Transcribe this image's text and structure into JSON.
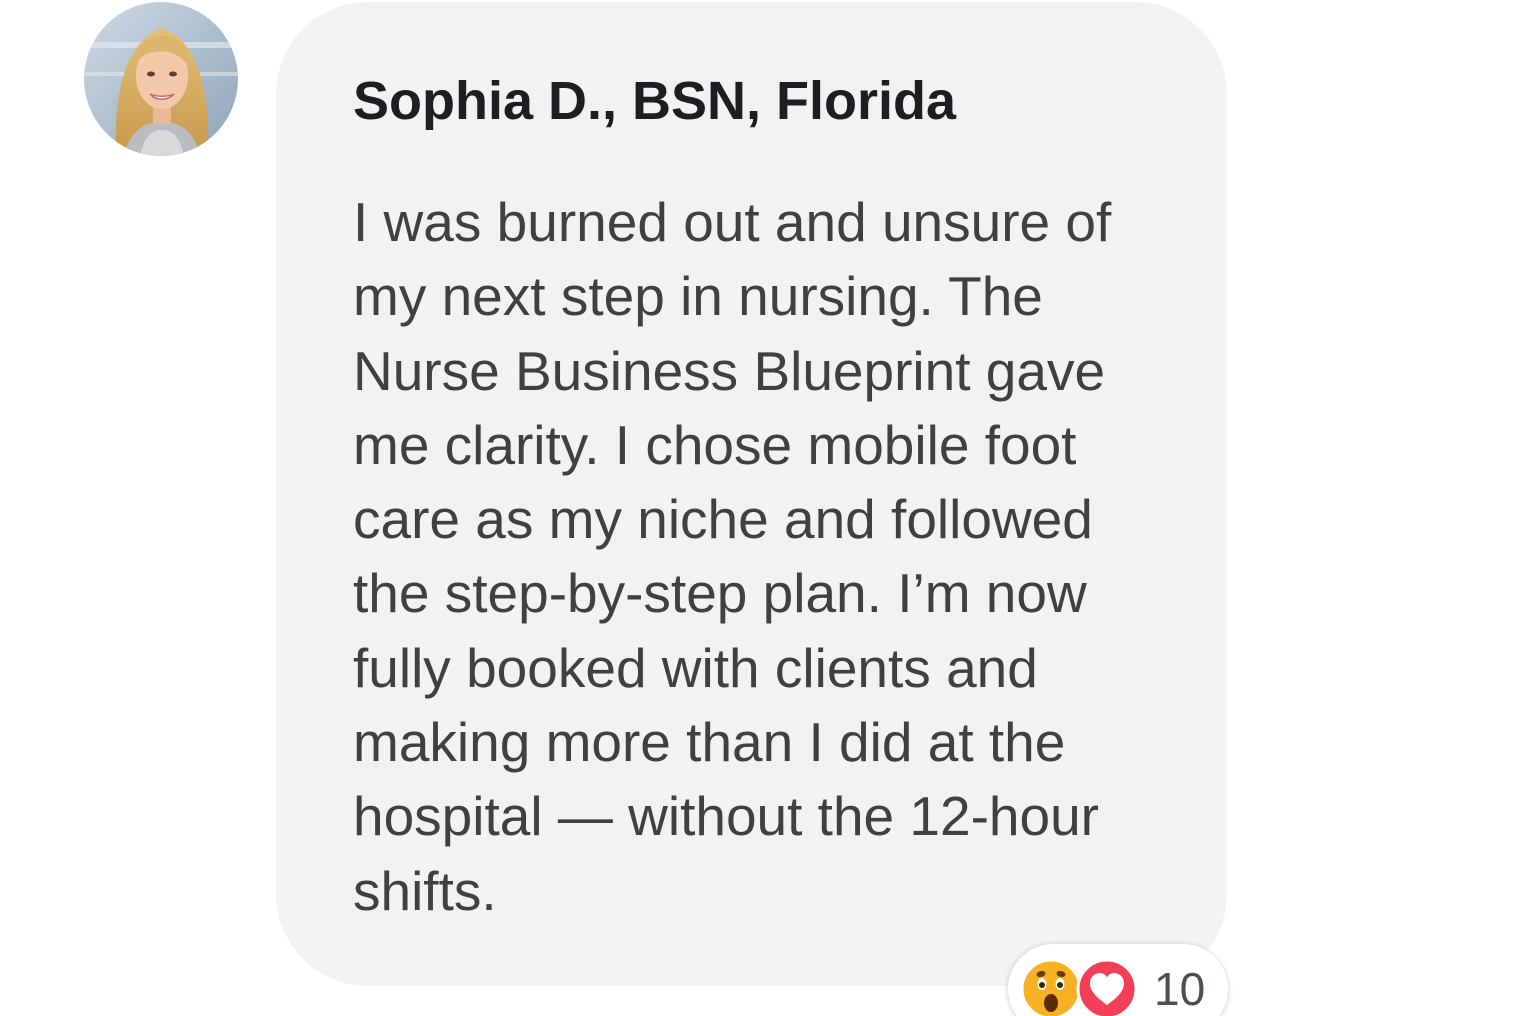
{
  "comment": {
    "author": "Sophia D., BSN, Florida",
    "avatar_icon": "profile-photo-avatar",
    "body_lines": [
      "I was burned out and unsure of",
      "my next step in nursing. The",
      "Nurse Business Blueprint gave",
      "me clarity. I chose mobile foot",
      "care as my niche and followed",
      "the step-by-step plan. I’m now",
      "fully booked with clients and",
      "making more than I did at the",
      "hospital — without the 12-hour",
      "shifts."
    ],
    "reactions": {
      "icons": [
        "wow-icon",
        "love-icon"
      ],
      "count": "10"
    }
  },
  "colors": {
    "bubble_bg": "#f1f2f4",
    "author_text": "#1c1e21",
    "body_text": "#3e4042",
    "love_red": "#f33e58",
    "wow_yellow": "#f7b125"
  }
}
